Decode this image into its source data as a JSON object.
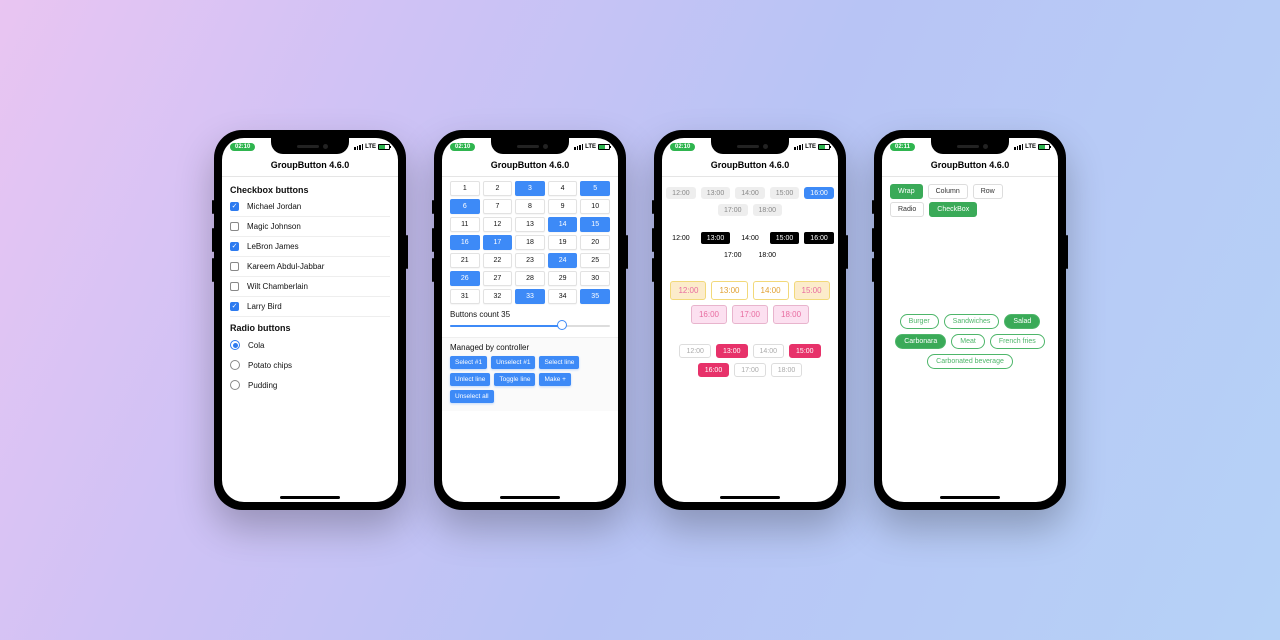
{
  "status": {
    "time_a": "02:10",
    "time_b": "02:11",
    "net": "LTE"
  },
  "title": "GroupButton 4.6.0",
  "p1": {
    "section_checkbox": "Checkbox buttons",
    "section_radio": "Radio buttons",
    "checkboxes": [
      {
        "label": "Michael Jordan",
        "checked": true
      },
      {
        "label": "Magic Johnson",
        "checked": false
      },
      {
        "label": "LeBron James",
        "checked": true
      },
      {
        "label": "Kareem Abdul-Jabbar",
        "checked": false
      },
      {
        "label": "Wilt Chamberlain",
        "checked": false
      },
      {
        "label": "Larry Bird",
        "checked": true
      }
    ],
    "radios": [
      {
        "label": "Cola",
        "checked": true
      },
      {
        "label": "Potato chips",
        "checked": false
      },
      {
        "label": "Pudding",
        "checked": false
      }
    ]
  },
  "p2": {
    "grid": [
      {
        "n": "1"
      },
      {
        "n": "2"
      },
      {
        "n": "3",
        "sel": true
      },
      {
        "n": "4"
      },
      {
        "n": "5",
        "sel": true
      },
      {
        "n": "6",
        "sel": true
      },
      {
        "n": "7"
      },
      {
        "n": "8"
      },
      {
        "n": "9"
      },
      {
        "n": "10"
      },
      {
        "n": "11"
      },
      {
        "n": "12"
      },
      {
        "n": "13"
      },
      {
        "n": "14",
        "sel": true
      },
      {
        "n": "15",
        "sel": true
      },
      {
        "n": "16",
        "sel": true
      },
      {
        "n": "17",
        "sel": true
      },
      {
        "n": "18"
      },
      {
        "n": "19"
      },
      {
        "n": "20"
      },
      {
        "n": "21"
      },
      {
        "n": "22"
      },
      {
        "n": "23"
      },
      {
        "n": "24",
        "sel": true
      },
      {
        "n": "25"
      },
      {
        "n": "26",
        "sel": true
      },
      {
        "n": "27"
      },
      {
        "n": "28"
      },
      {
        "n": "29"
      },
      {
        "n": "30"
      },
      {
        "n": "31"
      },
      {
        "n": "32"
      },
      {
        "n": "33",
        "sel": true
      },
      {
        "n": "34"
      },
      {
        "n": "35",
        "sel": true
      }
    ],
    "slider_label": "Buttons count 35",
    "slider_pct": 70,
    "panel_title": "Managed by controller",
    "actions": [
      "Select #1",
      "Unselect #1",
      "Select line",
      "Unlect line",
      "Toggle line",
      "Make +",
      "Unselect all"
    ]
  },
  "p3": {
    "times": [
      "12:00",
      "13:00",
      "14:00",
      "15:00",
      "16:00",
      "17:00",
      "18:00"
    ],
    "gA_sel": [
      4
    ],
    "gB_sel": [
      1,
      3,
      4
    ],
    "gC_sel": [
      0,
      3
    ],
    "gC_mid": [
      4,
      5,
      6
    ],
    "gD_sel": [
      1,
      3,
      4
    ]
  },
  "p4": {
    "layout": [
      {
        "t": "Wrap",
        "sel": true
      },
      {
        "t": "Column"
      },
      {
        "t": "Row"
      }
    ],
    "mode": [
      {
        "t": "Radio"
      },
      {
        "t": "CheckBox",
        "sel": true
      }
    ],
    "foods": [
      {
        "t": "Burger"
      },
      {
        "t": "Sandwiches"
      },
      {
        "t": "Salad",
        "sel": true
      },
      {
        "t": "Carbonara",
        "sel": true
      },
      {
        "t": "Meat"
      },
      {
        "t": "French fries"
      },
      {
        "t": "Carbonated beverage"
      }
    ]
  }
}
